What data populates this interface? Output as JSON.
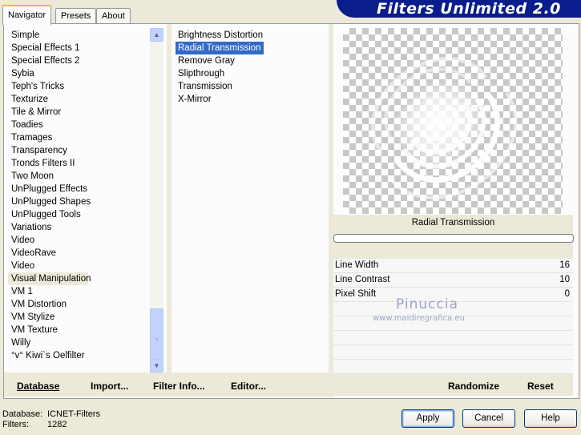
{
  "tabs": [
    {
      "label": "Navigator",
      "active": true
    },
    {
      "label": "Presets",
      "active": false
    },
    {
      "label": "About",
      "active": false
    }
  ],
  "app_title": "Filters Unlimited 2.0",
  "categories": [
    "Simple",
    "Special Effects 1",
    "Special Effects 2",
    "Sybia",
    "Teph's Tricks",
    "Texturize",
    "Tile & Mirror",
    "Toadies",
    "Tramages",
    "Transparency",
    "Tronds Filters II",
    "Two Moon",
    "UnPlugged Effects",
    "UnPlugged Shapes",
    "UnPlugged Tools",
    "Variations",
    "Video",
    "VideoRave",
    "Video",
    "Visual Manipulation",
    "VM 1",
    "VM Distortion",
    "VM Stylize",
    "VM Texture",
    "Willy",
    "°v° Kiwi`s Oelfilter"
  ],
  "selected_category": "Visual Manipulation",
  "filters": [
    "Brightness Distortion",
    "Radial Transmission",
    "Remove Gray",
    "Slipthrough",
    "Transmission",
    "X-Mirror"
  ],
  "selected_filter": "Radial Transmission",
  "preview_filter_name": "Radial Transmission",
  "params": [
    {
      "label": "Line Width",
      "value": "16"
    },
    {
      "label": "Line Contrast",
      "value": "10"
    },
    {
      "label": "Pixel Shift",
      "value": "0"
    }
  ],
  "watermark": {
    "name": "Pinuccia",
    "url": "www.maidiregrafica.eu"
  },
  "links": {
    "database": "Database",
    "import": "Import...",
    "filter_info": "Filter Info...",
    "editor": "Editor...",
    "randomize": "Randomize",
    "reset": "Reset"
  },
  "status": {
    "database_label": "Database:",
    "database_value": "ICNET-Filters",
    "filters_label": "Filters:",
    "filters_value": "1282"
  },
  "buttons": {
    "apply": "Apply",
    "cancel": "Cancel",
    "help": "Help"
  },
  "colors": {
    "banner": "#0a1d8c",
    "selection": "#316ac5",
    "dialog_bg": "#ece9d8"
  }
}
